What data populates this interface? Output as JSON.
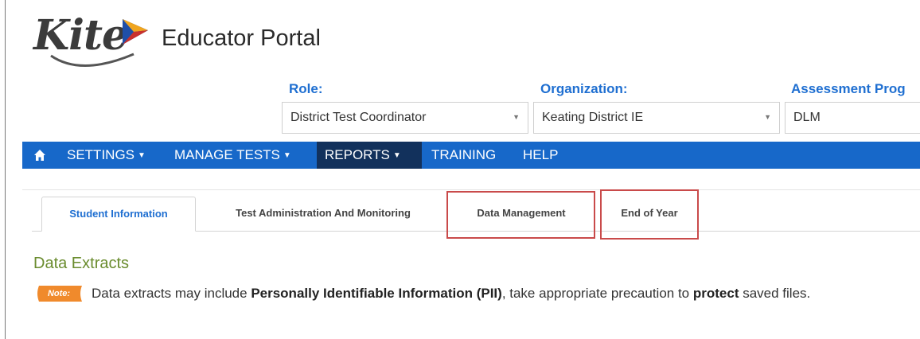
{
  "brand": {
    "logo_text": "Kite",
    "portal_title": "Educator Portal",
    "colors": {
      "nav_bg": "#1768c9",
      "nav_active": "#12315c",
      "label_blue": "#1f6fd1",
      "section_green": "#6a8c2e",
      "note_orange": "#f08a2c",
      "highlight_red": "#c94a4a"
    }
  },
  "selectors": {
    "role": {
      "label": "Role:",
      "value": "District Test Coordinator"
    },
    "organization": {
      "label": "Organization:",
      "value": "Keating District IE"
    },
    "assessment_program": {
      "label": "Assessment Prog",
      "value": "DLM"
    }
  },
  "nav": {
    "home_icon": "home-icon",
    "items": [
      {
        "label": "SETTINGS",
        "dropdown": true
      },
      {
        "label": "MANAGE TESTS",
        "dropdown": true
      },
      {
        "label": "REPORTS",
        "dropdown": true,
        "active": true
      },
      {
        "label": "TRAINING",
        "dropdown": false
      },
      {
        "label": "HELP",
        "dropdown": false
      }
    ]
  },
  "tabs": [
    {
      "label": "Student Information",
      "active": true
    },
    {
      "label": "Test Administration And Monitoring",
      "active": false
    },
    {
      "label": "Data Management",
      "active": false,
      "highlighted": true
    },
    {
      "label": "End of Year",
      "active": false,
      "highlighted": true
    }
  ],
  "content": {
    "section_title": "Data Extracts",
    "note_badge": "Note:",
    "note": {
      "part1": "Data extracts may include ",
      "bold1": "Personally Identifiable Information (PII)",
      "part2": ", take appropriate precaution to ",
      "bold2": "protect",
      "part3": " saved files."
    }
  }
}
